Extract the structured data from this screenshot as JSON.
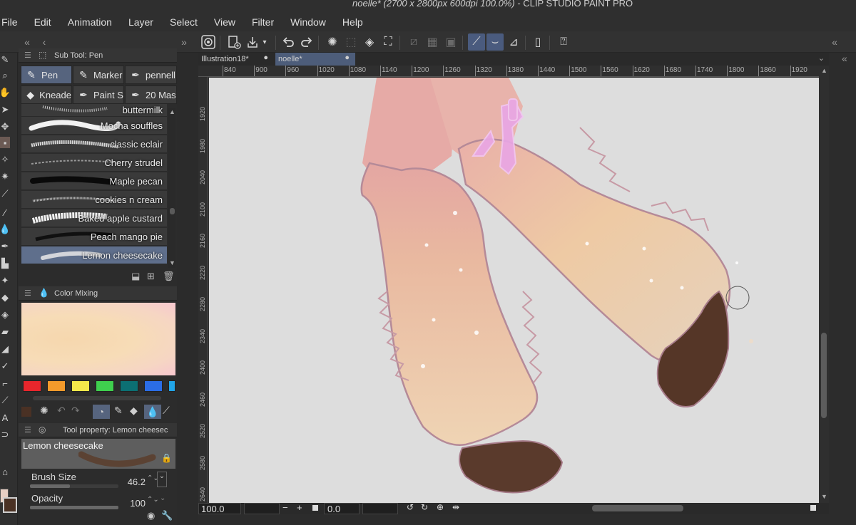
{
  "window": {
    "title_doc": "noelle*",
    "title_info": "(2700 x 2800px 600dpi 100.0%)",
    "title_app": " - CLIP STUDIO PAINT PRO"
  },
  "menu": [
    "File",
    "Edit",
    "Animation",
    "Layer",
    "Select",
    "View",
    "Filter",
    "Window",
    "Help"
  ],
  "panel_controls": {
    "collapse_left": "«",
    "back": "‹",
    "collapse_mid": "»",
    "collapse_right": "«"
  },
  "subtool_panel": {
    "title": "Sub Tool: Pen",
    "tabs": [
      {
        "label": "Pen",
        "icon": "pen-icon"
      },
      {
        "label": "Marker",
        "icon": "marker-icon"
      },
      {
        "label": "pennell",
        "icon": "pen-icon"
      },
      {
        "label": "Kneade",
        "icon": "eraser-icon"
      },
      {
        "label": "Paint S",
        "icon": "pen-icon"
      },
      {
        "label": "20 Mas",
        "icon": "pen-icon"
      }
    ],
    "brushes": [
      "buttermilk",
      "Mocha souffles",
      "classic eclair",
      "Cherry strudel",
      "Maple pecan",
      "cookies n cream",
      "Baked apple custard",
      "Peach mango pie",
      "Lemon cheesecake"
    ],
    "selected_brush": "Lemon cheesecake"
  },
  "color_mixing": {
    "title": "Color Mixing",
    "palette": [
      "#e8262c",
      "#f39a2b",
      "#f5e84a",
      "#3fcf4e",
      "#0c6f73",
      "#2b6de6",
      "#21a5e8"
    ]
  },
  "tool_property": {
    "title": "Tool property: Lemon cheesec",
    "brush_name": "Lemon cheesecake",
    "brush_size_label": "Brush Size",
    "brush_size_value": "46.2",
    "brush_size_fraction": 0.45,
    "opacity_label": "Opacity",
    "opacity_value": "100",
    "opacity_fraction": 1.0
  },
  "colors": {
    "main": "#e8cfc4",
    "sub": "#4a3124",
    "accent": "#56647e"
  },
  "document_tabs": [
    {
      "label": "Illustration18*",
      "active": false
    },
    {
      "label": "noelle*",
      "active": true
    }
  ],
  "ruler_top": [
    "840",
    "900",
    "960",
    "1020",
    "1080",
    "1140",
    "1200",
    "1260",
    "1320",
    "1380",
    "1440",
    "1500",
    "1560",
    "1620",
    "1680",
    "1740",
    "1800",
    "1860",
    "1920"
  ],
  "ruler_left": [
    "1920",
    "1980",
    "2040",
    "2100",
    "2160",
    "2220",
    "2280",
    "2340",
    "2400",
    "2460",
    "2520",
    "2580",
    "2640"
  ],
  "statusbar": {
    "zoom": "100.0",
    "minus": "−",
    "plus": "+",
    "rotation": "0.0"
  }
}
